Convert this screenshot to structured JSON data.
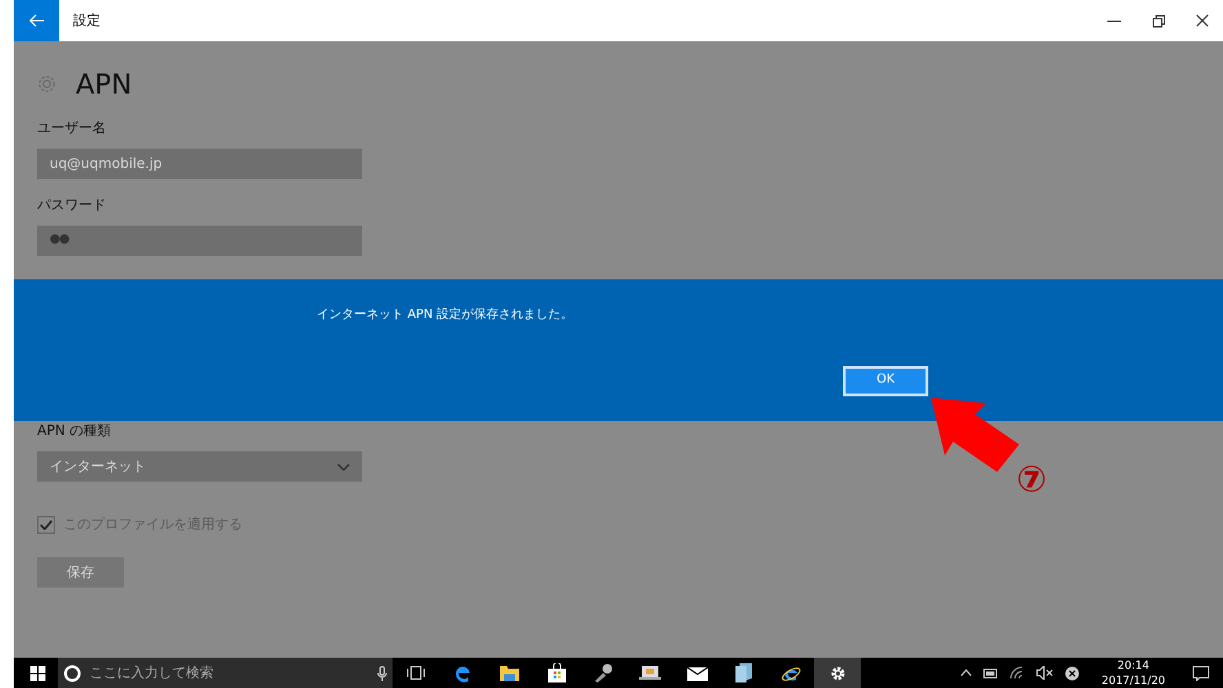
{
  "window": {
    "title": "設定"
  },
  "page": {
    "heading": "APN",
    "fields": [
      {
        "kind": "text",
        "label": "ユーザー名",
        "value": "uq@uqmobile.jp"
      },
      {
        "kind": "password",
        "label": "パスワード",
        "value": "●●"
      },
      {
        "kind": "dropdown",
        "label": "APN の種類",
        "value": "インターネット"
      }
    ],
    "checkbox": {
      "label": "このプロファイルを適用する",
      "checked": true
    },
    "save_button": "保存"
  },
  "dialog": {
    "message": "インターネット APN 設定が保存されました。",
    "button": "OK"
  },
  "annotation": {
    "step": "⑦"
  },
  "taskbar": {
    "search_placeholder": "ここに入力して検索",
    "time": "20:14",
    "date": "2017/11/20"
  }
}
